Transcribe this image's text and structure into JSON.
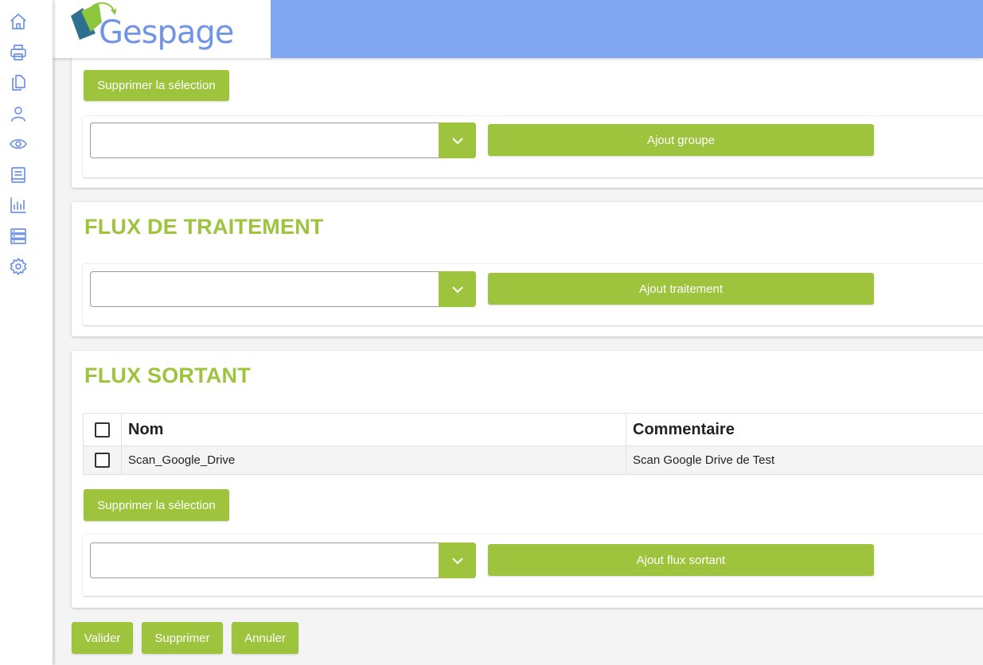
{
  "header": {
    "logo_text": "Gespage"
  },
  "sidebar": {
    "icons": [
      "home-icon",
      "printer-icon",
      "documents-icon",
      "user-icon",
      "eye-icon",
      "book-icon",
      "bar-chart-icon",
      "server-icon",
      "gear-icon"
    ]
  },
  "groups_section": {
    "delete_selection_label": "Supprimer la sélection",
    "select_value": "",
    "add_button_label": "Ajout groupe"
  },
  "processing_section": {
    "title": "FLUX DE TRAITEMENT",
    "select_value": "",
    "add_button_label": "Ajout traitement"
  },
  "outgoing_section": {
    "title": "FLUX SORTANT",
    "table": {
      "columns": [
        "Nom",
        "Commentaire"
      ],
      "rows": [
        {
          "nom": "Scan_Google_Drive",
          "commentaire": "Scan Google Drive de Test"
        }
      ]
    },
    "delete_selection_label": "Supprimer la sélection",
    "select_value": "",
    "add_button_label": "Ajout flux sortant"
  },
  "footer": {
    "validate_label": "Valider",
    "delete_label": "Supprimer",
    "cancel_label": "Annuler"
  },
  "colors": {
    "accent_green": "#9dc43c",
    "header_blue": "#81a7f2",
    "icon_blue": "#6f94e8"
  }
}
